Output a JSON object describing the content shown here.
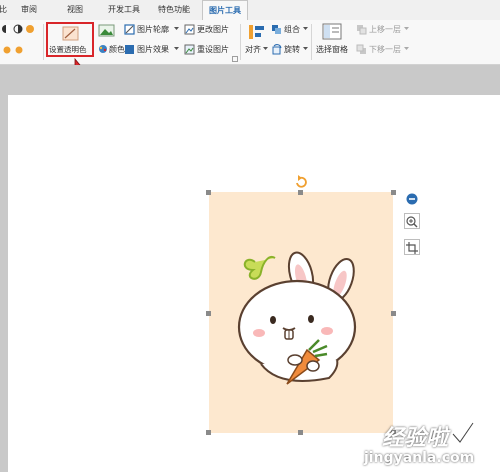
{
  "tabs": [
    {
      "label": "审阅"
    },
    {
      "label": "视图"
    },
    {
      "label": "开发工具"
    },
    {
      "label": "特色功能"
    },
    {
      "label": "图片工具"
    }
  ],
  "tab_fragment": "比",
  "ribbon": {
    "set_transparent": "设置透明色",
    "color": "颜色",
    "picture_outline": "图片轮廓",
    "picture_effects": "图片效果",
    "change_picture": "更改图片",
    "reset_picture": "重设图片",
    "align": "对齐",
    "group": "组合",
    "rotate": "旋转",
    "selection_pane": "选择窗格",
    "bring_forward": "上移一层",
    "send_backward": "下移一层"
  },
  "watermark": {
    "title": "经验啦",
    "url": "jingyanla.com"
  },
  "colors": {
    "highlight": "#d9262a",
    "image_bg": "#fde8cf",
    "carrot": "#f08b3c",
    "leaf": "#b9d33a"
  }
}
